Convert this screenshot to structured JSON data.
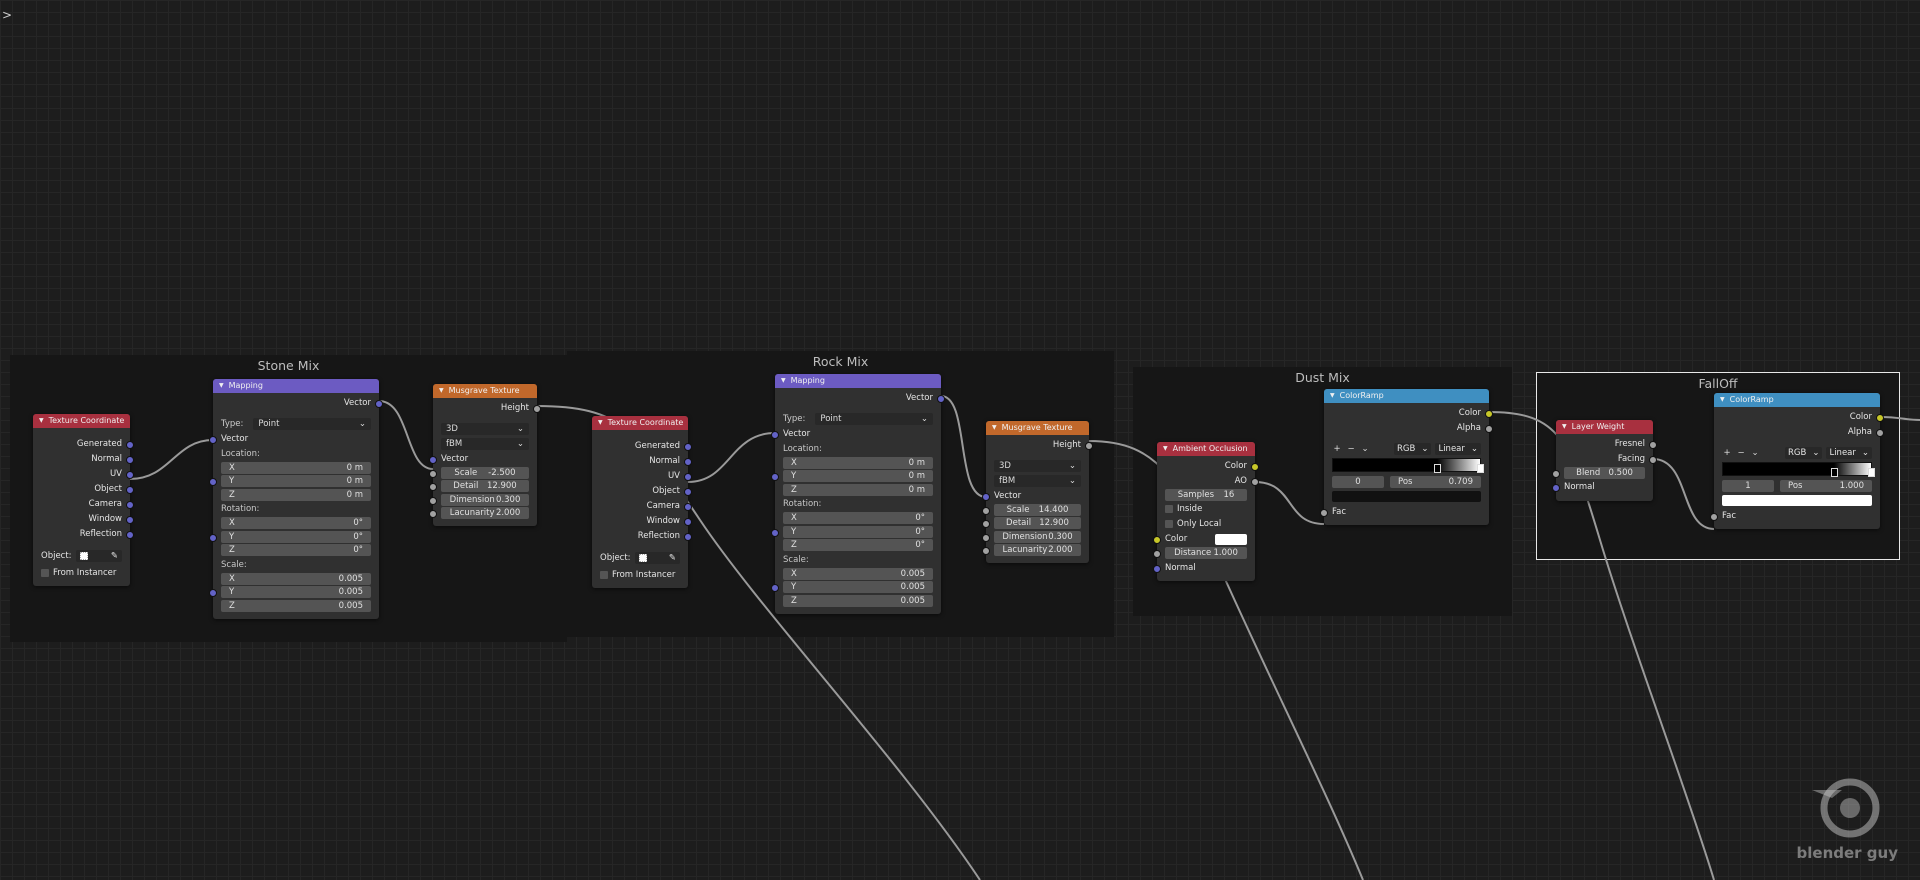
{
  "ui": {
    "sidebar_toggle": ">",
    "watermark": "blender guy"
  },
  "socket_colors": {
    "vector": "#6363c7",
    "float": "#a1a1a1",
    "color": "#c7c729"
  },
  "header_colors": {
    "input": "#a8303f",
    "vector": "#6c5bc2",
    "texture": "#c1682b",
    "converter": "#3f8fc1",
    "shader": "#a8303f"
  },
  "frames": [
    {
      "title": "Stone Mix",
      "nodes": [
        {
          "title": "Texture Coordinate",
          "kind": "input",
          "rows": [
            {
              "t": "spacer"
            },
            {
              "t": "out",
              "label": "Generated",
              "sock": "vector"
            },
            {
              "t": "out",
              "label": "Normal",
              "sock": "vector"
            },
            {
              "t": "out",
              "label": "UV",
              "sock": "vector"
            },
            {
              "t": "out",
              "label": "Object",
              "sock": "vector"
            },
            {
              "t": "out",
              "label": "Camera",
              "sock": "vector"
            },
            {
              "t": "out",
              "label": "Window",
              "sock": "vector"
            },
            {
              "t": "out",
              "label": "Reflection",
              "sock": "vector"
            },
            {
              "t": "spacer"
            },
            {
              "t": "object",
              "label": "Object:"
            },
            {
              "t": "check",
              "label": "From Instancer"
            }
          ]
        },
        {
          "title": "Mapping",
          "kind": "vector",
          "rows": [
            {
              "t": "out",
              "label": "Vector",
              "sock": "vector"
            },
            {
              "t": "spacer"
            },
            {
              "t": "select",
              "label": "Type:",
              "value": "Point"
            },
            {
              "t": "in",
              "label": "Vector",
              "sock": "vector"
            },
            {
              "t": "heading",
              "label": "Location:"
            },
            {
              "t": "field",
              "label": "X",
              "value": "0 m"
            },
            {
              "t": "field",
              "label": "Y",
              "value": "0 m",
              "sock": "vector"
            },
            {
              "t": "field",
              "label": "Z",
              "value": "0 m"
            },
            {
              "t": "heading",
              "label": "Rotation:"
            },
            {
              "t": "field",
              "label": "X",
              "value": "0°"
            },
            {
              "t": "field",
              "label": "Y",
              "value": "0°",
              "sock": "vector"
            },
            {
              "t": "field",
              "label": "Z",
              "value": "0°"
            },
            {
              "t": "heading",
              "label": "Scale:"
            },
            {
              "t": "field",
              "label": "X",
              "value": "0.005"
            },
            {
              "t": "field",
              "label": "Y",
              "value": "0.005",
              "sock": "vector"
            },
            {
              "t": "field",
              "label": "Z",
              "value": "0.005"
            }
          ]
        },
        {
          "title": "Musgrave Texture",
          "kind": "texture",
          "rows": [
            {
              "t": "out",
              "label": "Height",
              "sock": "float"
            },
            {
              "t": "spacer"
            },
            {
              "t": "select",
              "value": "3D"
            },
            {
              "t": "select",
              "value": "fBM"
            },
            {
              "t": "in",
              "label": "Vector",
              "sock": "vector"
            },
            {
              "t": "field",
              "label": "Scale",
              "value": "-2.500",
              "sock": "float",
              "center": true
            },
            {
              "t": "field",
              "label": "Detail",
              "value": "12.900",
              "sock": "float",
              "center": true
            },
            {
              "t": "field",
              "label": "Dimension",
              "value": "0.300",
              "sock": "float",
              "center": true
            },
            {
              "t": "field",
              "label": "Lacunarity",
              "value": "2.000",
              "sock": "float",
              "center": true
            }
          ]
        }
      ]
    },
    {
      "title": "Rock Mix",
      "nodes": [
        {
          "title": "Texture Coordinate",
          "kind": "input",
          "rows": [
            {
              "t": "spacer"
            },
            {
              "t": "out",
              "label": "Generated",
              "sock": "vector"
            },
            {
              "t": "out",
              "label": "Normal",
              "sock": "vector"
            },
            {
              "t": "out",
              "label": "UV",
              "sock": "vector"
            },
            {
              "t": "out",
              "label": "Object",
              "sock": "vector"
            },
            {
              "t": "out",
              "label": "Camera",
              "sock": "vector"
            },
            {
              "t": "out",
              "label": "Window",
              "sock": "vector"
            },
            {
              "t": "out",
              "label": "Reflection",
              "sock": "vector"
            },
            {
              "t": "spacer"
            },
            {
              "t": "object",
              "label": "Object:"
            },
            {
              "t": "check",
              "label": "From Instancer"
            }
          ]
        },
        {
          "title": "Mapping",
          "kind": "vector",
          "rows": [
            {
              "t": "out",
              "label": "Vector",
              "sock": "vector"
            },
            {
              "t": "spacer"
            },
            {
              "t": "select",
              "label": "Type:",
              "value": "Point"
            },
            {
              "t": "in",
              "label": "Vector",
              "sock": "vector"
            },
            {
              "t": "heading",
              "label": "Location:"
            },
            {
              "t": "field",
              "label": "X",
              "value": "0 m"
            },
            {
              "t": "field",
              "label": "Y",
              "value": "0 m",
              "sock": "vector"
            },
            {
              "t": "field",
              "label": "Z",
              "value": "0 m"
            },
            {
              "t": "heading",
              "label": "Rotation:"
            },
            {
              "t": "field",
              "label": "X",
              "value": "0°"
            },
            {
              "t": "field",
              "label": "Y",
              "value": "0°",
              "sock": "vector"
            },
            {
              "t": "field",
              "label": "Z",
              "value": "0°"
            },
            {
              "t": "heading",
              "label": "Scale:"
            },
            {
              "t": "field",
              "label": "X",
              "value": "0.005"
            },
            {
              "t": "field",
              "label": "Y",
              "value": "0.005",
              "sock": "vector"
            },
            {
              "t": "field",
              "label": "Z",
              "value": "0.005"
            }
          ]
        },
        {
          "title": "Musgrave Texture",
          "kind": "texture",
          "rows": [
            {
              "t": "out",
              "label": "Height",
              "sock": "float"
            },
            {
              "t": "spacer"
            },
            {
              "t": "select",
              "value": "3D"
            },
            {
              "t": "select",
              "value": "fBM"
            },
            {
              "t": "in",
              "label": "Vector",
              "sock": "vector"
            },
            {
              "t": "field",
              "label": "Scale",
              "value": "14.400",
              "sock": "float",
              "center": true
            },
            {
              "t": "field",
              "label": "Detail",
              "value": "12.900",
              "sock": "float",
              "center": true
            },
            {
              "t": "field",
              "label": "Dimension",
              "value": "0.300",
              "sock": "float",
              "center": true
            },
            {
              "t": "field",
              "label": "Lacunarity",
              "value": "2.000",
              "sock": "float",
              "center": true
            }
          ]
        }
      ]
    },
    {
      "title": "Dust Mix",
      "nodes": [
        {
          "title": "Ambient Occlusion",
          "kind": "shader",
          "rows": [
            {
              "t": "out",
              "label": "Color",
              "sock": "color"
            },
            {
              "t": "out",
              "label": "AO",
              "sock": "float"
            },
            {
              "t": "field",
              "label": "Samples",
              "value": "16",
              "center": true
            },
            {
              "t": "check",
              "label": "Inside"
            },
            {
              "t": "check",
              "label": "Only Local"
            },
            {
              "t": "color-in",
              "label": "Color",
              "sock": "color",
              "color": "#ffffff"
            },
            {
              "t": "field",
              "label": "Distance",
              "value": "1.000",
              "sock": "float",
              "center": true
            },
            {
              "t": "in",
              "label": "Normal",
              "sock": "vector"
            }
          ]
        },
        {
          "title": "ColorRamp",
          "kind": "converter",
          "rows": [
            {
              "t": "out",
              "label": "Color",
              "sock": "color"
            },
            {
              "t": "out",
              "label": "Alpha",
              "sock": "float"
            },
            {
              "t": "spacer"
            },
            {
              "t": "ramp-tools",
              "mode": "RGB",
              "interp": "Linear"
            },
            {
              "t": "ramp",
              "stops": [
                {
                  "pos": 0.709,
                  "color": "#000000"
                },
                {
                  "pos": 1.0,
                  "color": "#ffffff"
                }
              ]
            },
            {
              "t": "ramp-pos",
              "index": "0",
              "label": "Pos",
              "value": "0.709"
            },
            {
              "t": "swatch",
              "color": "#111111"
            },
            {
              "t": "in",
              "label": "Fac",
              "sock": "float"
            }
          ]
        }
      ]
    },
    {
      "title": "FallOff",
      "nodes": [
        {
          "title": "Layer Weight",
          "kind": "input",
          "rows": [
            {
              "t": "out",
              "label": "Fresnel",
              "sock": "float"
            },
            {
              "t": "out",
              "label": "Facing",
              "sock": "float"
            },
            {
              "t": "field",
              "label": "Blend",
              "value": "0.500",
              "sock": "float",
              "center": true
            },
            {
              "t": "in",
              "label": "Normal",
              "sock": "vector"
            }
          ]
        },
        {
          "title": "ColorRamp",
          "kind": "converter",
          "rows": [
            {
              "t": "out",
              "label": "Color",
              "sock": "color"
            },
            {
              "t": "out",
              "label": "Alpha",
              "sock": "float"
            },
            {
              "t": "spacer"
            },
            {
              "t": "ramp-tools",
              "mode": "RGB",
              "interp": "Linear"
            },
            {
              "t": "ramp",
              "stops": [
                {
                  "pos": 0.75,
                  "color": "#000000"
                },
                {
                  "pos": 1.0,
                  "color": "#ffffff"
                }
              ]
            },
            {
              "t": "ramp-pos",
              "index": "1",
              "label": "Pos",
              "value": "1.000"
            },
            {
              "t": "swatch",
              "color": "#ffffff"
            },
            {
              "t": "in",
              "label": "Fac",
              "sock": "float"
            }
          ]
        }
      ]
    }
  ]
}
